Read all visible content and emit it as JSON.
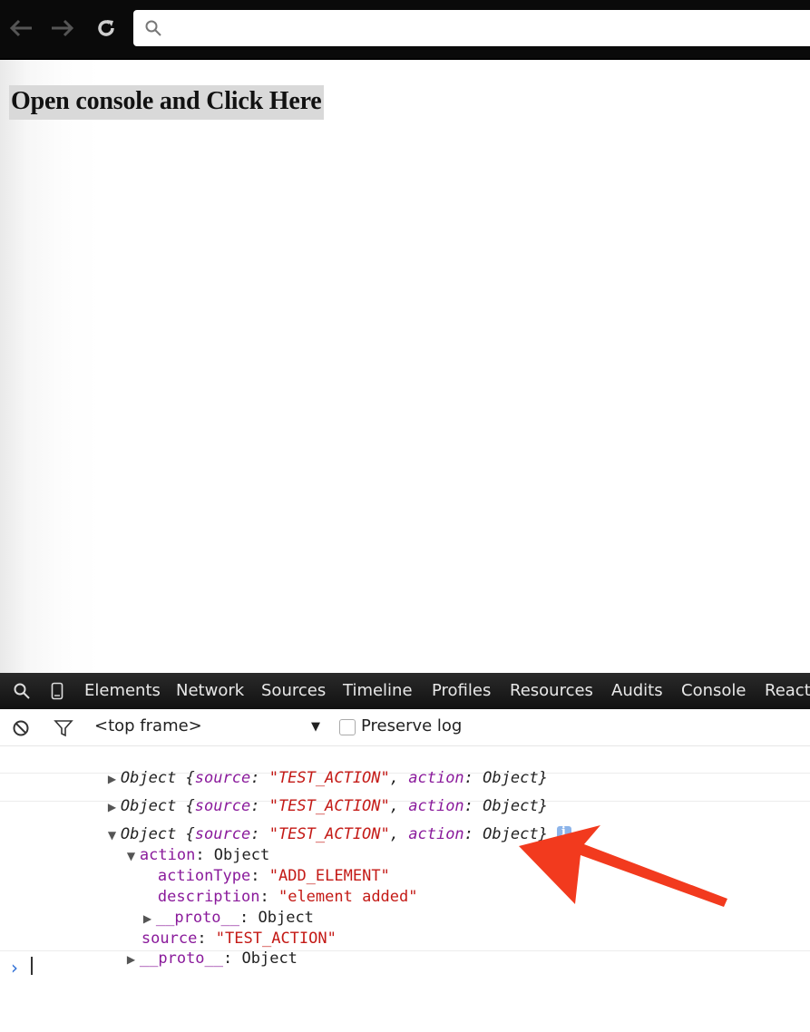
{
  "page": {
    "button_text": "Open console and Click Here"
  },
  "devtools": {
    "tabs": [
      "Elements",
      "Network",
      "Sources",
      "Timeline",
      "Profiles",
      "Resources",
      "Audits",
      "Console",
      "React"
    ],
    "frame_select": "<top frame>",
    "preserve_log_label": "Preserve log",
    "log": {
      "obj_word": "Object",
      "brace_open": " {",
      "source_key": "source",
      "source_value": "\"TEST_ACTION\"",
      "action_key": "action",
      "action_value": "Object}",
      "expanded": {
        "action_label": "action",
        "action_type": "Object",
        "action_type_key": "actionType",
        "action_type_value": "\"ADD_ELEMENT\"",
        "description_key": "description",
        "description_value": "\"element added\"",
        "proto_key": "__proto__",
        "proto_value": "Object",
        "source_key": "source",
        "source_value": "\"TEST_ACTION\""
      }
    }
  },
  "colors": {
    "annotation_arrow": "#f23a1e",
    "string": "#c41a16",
    "property_key": "#8a1a9b",
    "prompt": "#2f6fd6"
  },
  "icons": {
    "back": "back-arrow-icon",
    "forward": "forward-arrow-icon",
    "reload": "reload-icon",
    "search": "search-icon",
    "clear": "clear-console-icon",
    "filter": "filter-icon",
    "device": "device-mode-icon",
    "info": "info-icon",
    "arrow": "annotation-arrow-icon"
  }
}
